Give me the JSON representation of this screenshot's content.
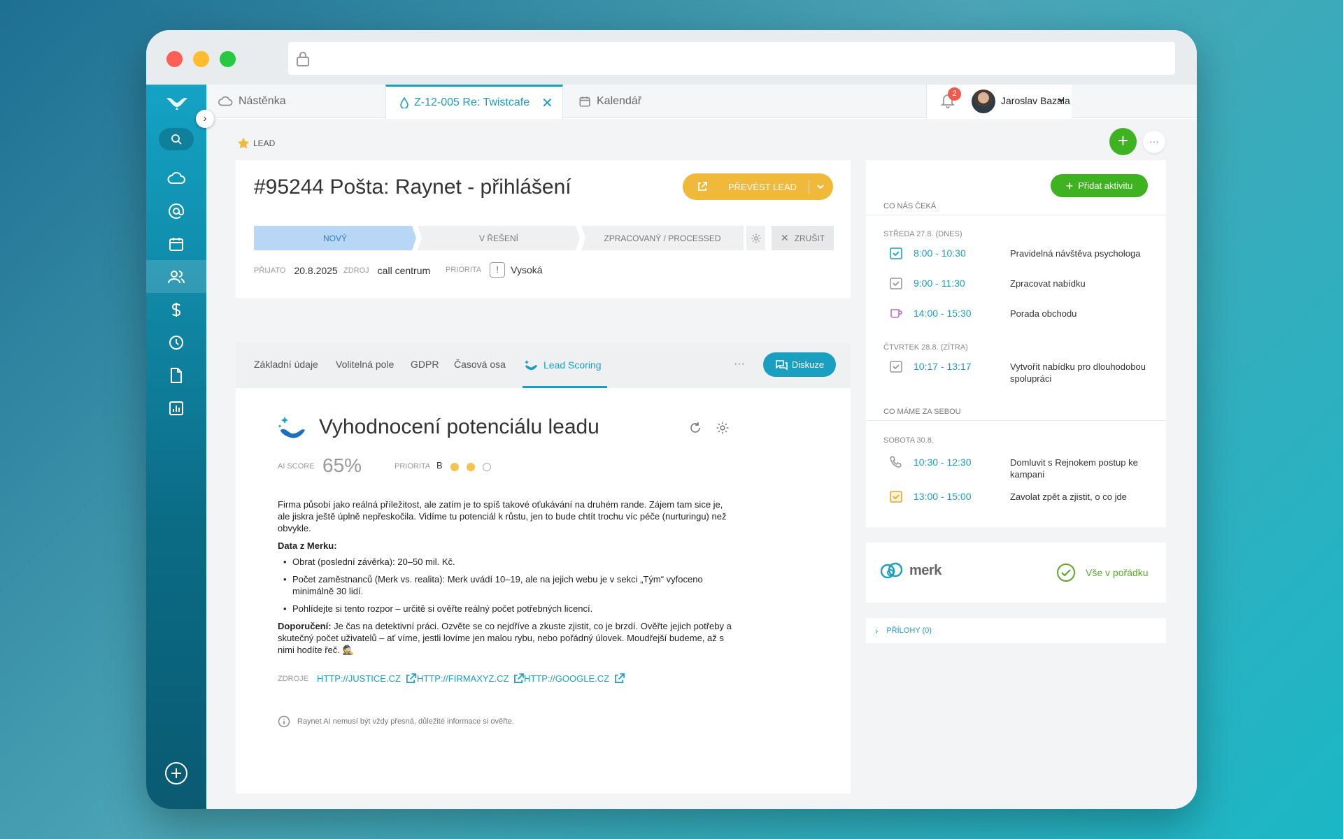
{
  "tabs": [
    {
      "label": "Nástěnka",
      "icon": "cloud-icon"
    },
    {
      "label": "Z-12-005 Re: Twistcafe",
      "icon": "drop-icon"
    },
    {
      "label": "Kalendář",
      "icon": "calendar-icon"
    }
  ],
  "tab_more": "···",
  "user": {
    "name": "Jaroslav Bazala",
    "notifications": "2"
  },
  "record": {
    "type_label": "LEAD",
    "title": "#95244 Pošta: Raynet - přihlášení",
    "convert_label": "PŘEVÉST LEAD",
    "stages": [
      "NOVÝ",
      "V ŘEŠENÍ",
      "ZPRACOVANÝ / PROCESSED"
    ],
    "cancel_label": "ZRUŠIT",
    "meta": {
      "received_label": "PŘIJATO",
      "received": "20.8.2025",
      "source_label": "ZDROJ",
      "source": "call centrum",
      "priority_label": "PRIORITA",
      "priority_icon": "!",
      "priority": "Vysoká"
    }
  },
  "subtabs": [
    "Základní údaje",
    "Volitelná pole",
    "GDPR",
    "Časová osa",
    "Lead Scoring"
  ],
  "subtab_more": "···",
  "discussion_label": "Diskuze",
  "ai": {
    "title": "Vyhodnocení potenciálu leadu",
    "score_label": "AI SCORE",
    "score": "65%",
    "priority_label": "PRIORITA",
    "priority": "B",
    "priority_level": {
      "filled": 2,
      "total": 3
    },
    "paragraph": "Firma působí jako reálná příležitost, ale zatím je to spíš takové oťukávání na druhém rande. Zájem tam sice je, ale jiskra ještě úplně nepřeskočila. Vidíme tu potenciál k růstu, jen to bude chtít trochu víc péče (nurturingu) než obvykle.",
    "data_heading": "Data z Merku:",
    "bullets": [
      "Obrat (poslední závěrka): 20–50 mil. Kč.",
      "Počet zaměstnanců (Merk vs. realita): Merk uvádí 10–19, ale na jejich webu je v sekci „Tým“ vyfoceno minimálně 30 lidí.",
      "Pohlídejte si tento rozpor – určitě si ověřte reálný počet potřebných licencí."
    ],
    "recommendation_label": "Doporučení:",
    "recommendation": " Je čas na detektivní práci. Ozvěte se co nejdříve a zkuste zjistit, co je brzdí. Ověřte jejich potřeby a skutečný počet uživatelů – ať víme, jestli lovíme jen malou rybu, nebo pořádný úlovek. Moudřejší budeme, až s nimi hodíte řeč. 🕵️",
    "sources_label": "ZDROJE",
    "sources": [
      "HTTP://JUSTICE.CZ",
      "HTTP://FIRMAXYZ.CZ",
      "HTTP://GOOGLE.CZ"
    ],
    "disclaimer": "Raynet AI nemusí být vždy přesná, důležité informace si ověřte."
  },
  "activities": {
    "add_label": "Přidat aktivitu",
    "upcoming_label": "CO NÁS ČEKÁ",
    "days": [
      {
        "label": "STŘEDA 27.8. (DNES)",
        "items": [
          {
            "time": "8:00 - 10:30",
            "name": "Pravidelná návštěva psychologa",
            "icon": "task-icon"
          },
          {
            "time": "9:00 - 11:30",
            "name": "Zpracovat nabídku",
            "icon": "task-icon"
          },
          {
            "time": "14:00 - 15:30",
            "name": "Porada obchodu",
            "icon": "coffee-icon"
          }
        ]
      },
      {
        "label": "ČTVRTEK 28.8. (ZÍTRA)",
        "items": [
          {
            "time": "10:17 - 13:17",
            "name": "Vytvořit nabídku pro dlouhodobou spolupráci",
            "icon": "task-icon"
          }
        ]
      }
    ],
    "past_label": "CO MÁME ZA SEBOU",
    "past_days": [
      {
        "label": "SOBOTA 30.8.",
        "items": [
          {
            "time": "10:30 - 12:30",
            "name": "Domluvit s Rejnokem postup ke kampani",
            "icon": "phone-icon"
          },
          {
            "time": "13:00 - 15:00",
            "name": "Zavolat zpět a zjistit, o co jde",
            "icon": "task-icon"
          }
        ]
      }
    ]
  },
  "merk": {
    "logo": "merk",
    "status": "Vše v pořádku"
  },
  "attachments_label": "PŘÍLOHY (0)",
  "colors": {
    "accent": "#1a9fc0",
    "green": "#3fb222",
    "orange": "#f0b93a",
    "stage_active": "#b8d6f6"
  }
}
